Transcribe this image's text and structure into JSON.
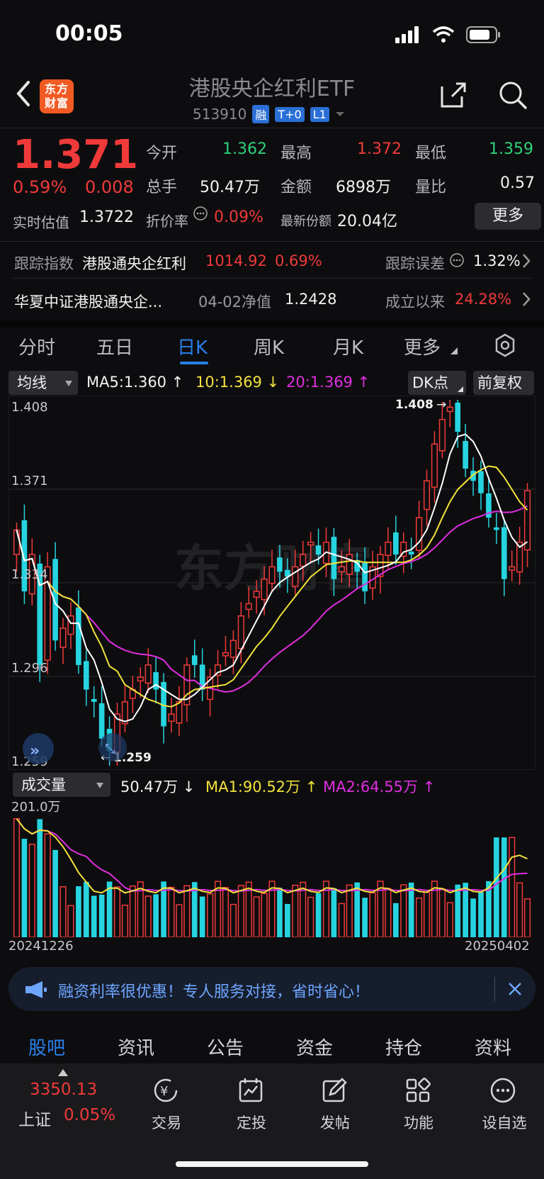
{
  "status": {
    "time": "00:05"
  },
  "header": {
    "title": "港股央企红利ETF",
    "code": "513910",
    "tags": [
      "融",
      "T+0",
      "L1"
    ],
    "logo_line1": "东方",
    "logo_line2": "财富"
  },
  "quote": {
    "price": "1.371",
    "change_pct": "0.59%",
    "change": "0.008",
    "open_label": "今开",
    "open": "1.362",
    "high_label": "最高",
    "high": "1.372",
    "low_label": "最低",
    "low": "1.359",
    "volume_label": "总手",
    "volume": "50.47万",
    "amount_label": "金额",
    "amount": "6898万",
    "ratio_label": "量比",
    "ratio": "0.57",
    "est_label": "实时估值",
    "est": "1.3722",
    "discount_label": "折价率",
    "discount": "0.09%",
    "shares_label": "最新份额",
    "shares": "20.04亿",
    "more_label": "更多"
  },
  "info": {
    "track_label": "跟踪指数",
    "track_name": "港股通央企红利",
    "track_value": "1014.92",
    "track_pct": "0.69%",
    "error_label": "跟踪误差",
    "error_value": "1.32%",
    "fund_name": "华夏中证港股通央企...",
    "nav_label": "04-02净值",
    "nav_value": "1.2428",
    "since_label": "成立以来",
    "since_value": "24.28%"
  },
  "tabs": [
    "分时",
    "五日",
    "日K",
    "周K",
    "月K",
    "更多"
  ],
  "chart": {
    "ma_pill": "均线",
    "ma5": "MA5:1.360",
    "ma10": "10:1.369",
    "ma20": "20:1.369",
    "dk_label": "DK点",
    "adj_label": "前复权",
    "y_labels": [
      "1.408",
      "1.371",
      "1.334",
      "1.296",
      "1.259"
    ],
    "max_label": "1.408",
    "min_label": "1.259",
    "vol_pill": "成交量",
    "vol_value": "50.47万",
    "vol_ma1": "MA1:90.52万",
    "vol_ma2": "MA2:64.55万",
    "vol_max_label": "201.0万",
    "date_start": "20241226",
    "date_end": "20250402",
    "colors": {
      "up": "#f03a3a",
      "down": "#26d4e0",
      "ma5": "#ffffff",
      "ma10": "#f3e33a",
      "ma20": "#e02ee0"
    }
  },
  "chart_data": {
    "type": "candlestick",
    "ylim": [
      1.259,
      1.408
    ],
    "x_range": [
      "20241226",
      "20250402"
    ],
    "closes": [
      1.355,
      1.33,
      1.345,
      1.3,
      1.34,
      1.31,
      1.315,
      1.32,
      1.3,
      1.29,
      1.285,
      1.27,
      1.265,
      1.28,
      1.285,
      1.29,
      1.295,
      1.3,
      1.29,
      1.275,
      1.28,
      1.285,
      1.3,
      1.3,
      1.29,
      1.295,
      1.3,
      1.305,
      1.31,
      1.32,
      1.325,
      1.33,
      1.335,
      1.34,
      1.338,
      1.336,
      1.34,
      1.345,
      1.35,
      1.345,
      1.35,
      1.335,
      1.34,
      1.345,
      1.338,
      1.33,
      1.34,
      1.345,
      1.35,
      1.345,
      1.35,
      1.345,
      1.36,
      1.375,
      1.39,
      1.4,
      1.405,
      1.395,
      1.38,
      1.375,
      1.37,
      1.36,
      1.355,
      1.335,
      1.34,
      1.35,
      1.371
    ],
    "volume_max": "201.0万"
  },
  "banner": {
    "text": "融资利率很优惠！专人服务对接，省时省心！"
  },
  "bottom_tabs": [
    "股吧",
    "资讯",
    "公告",
    "资金",
    "持仓",
    "资料"
  ],
  "index": {
    "value": "3350.13",
    "name": "上证",
    "pct": "0.05%"
  },
  "nav": [
    "交易",
    "定投",
    "发帖",
    "功能",
    "设自选"
  ]
}
